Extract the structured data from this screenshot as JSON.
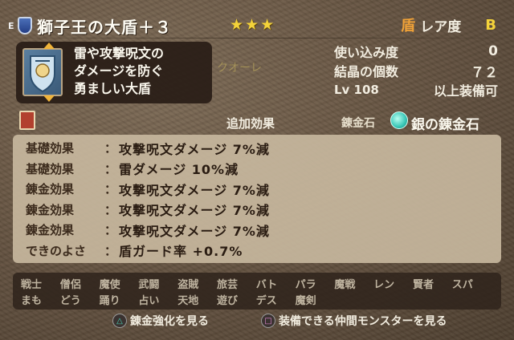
{
  "header": {
    "equip_mark": "E",
    "item_name": "獅子王の大盾＋３",
    "stars": "★★★",
    "rarity_icon": "盾",
    "rarity_label": "レア度",
    "rarity_value": "B"
  },
  "description": {
    "lines": [
      "雷や攻撃呪文の",
      "ダメージを防ぐ",
      "勇ましい大盾"
    ]
  },
  "watermark": "クオーレ",
  "stats": {
    "usage_label": "使い込み度",
    "usage_value": "0",
    "crystal_label": "結晶の個数",
    "crystal_value": "７２",
    "level_badge": "Lv 108",
    "level_suffix": "以上装備可"
  },
  "section": {
    "title": "追加効果",
    "alchemy_label": "錬金石",
    "alchemy_stone": "銀の錬金石"
  },
  "effects": [
    {
      "label": "基礎効果",
      "text": "攻撃呪文ダメージ 7%減"
    },
    {
      "label": "基礎効果",
      "text": "雷ダメージ 10%減"
    },
    {
      "label": "錬金効果",
      "text": "攻撃呪文ダメージ 7%減"
    },
    {
      "label": "錬金効果",
      "text": "攻撃呪文ダメージ 7%減"
    },
    {
      "label": "錬金効果",
      "text": "攻撃呪文ダメージ 7%減"
    },
    {
      "label": "できのよさ",
      "text": "盾ガード率 +0.7%"
    }
  ],
  "effect_colon": "：",
  "jobs": {
    "row1": [
      "戦士",
      "僧侶",
      "魔使",
      "武闘",
      "盗賊",
      "旅芸",
      "バト",
      "パラ",
      "魔戦",
      "レン",
      "賢者",
      "スパ"
    ],
    "row2": [
      "まも",
      "どう",
      "踊り",
      "占い",
      "天地",
      "遊び",
      "デス",
      "魔剣"
    ]
  },
  "footer": {
    "triangle_glyph": "△",
    "triangle_label": "錬金強化を見る",
    "square_glyph": "□",
    "square_label": "装備できる仲間モンスターを見る"
  },
  "colors": {
    "star": "#f4d33a",
    "rarity_icon": "#f0a238",
    "panel": "#c9b9a0"
  }
}
